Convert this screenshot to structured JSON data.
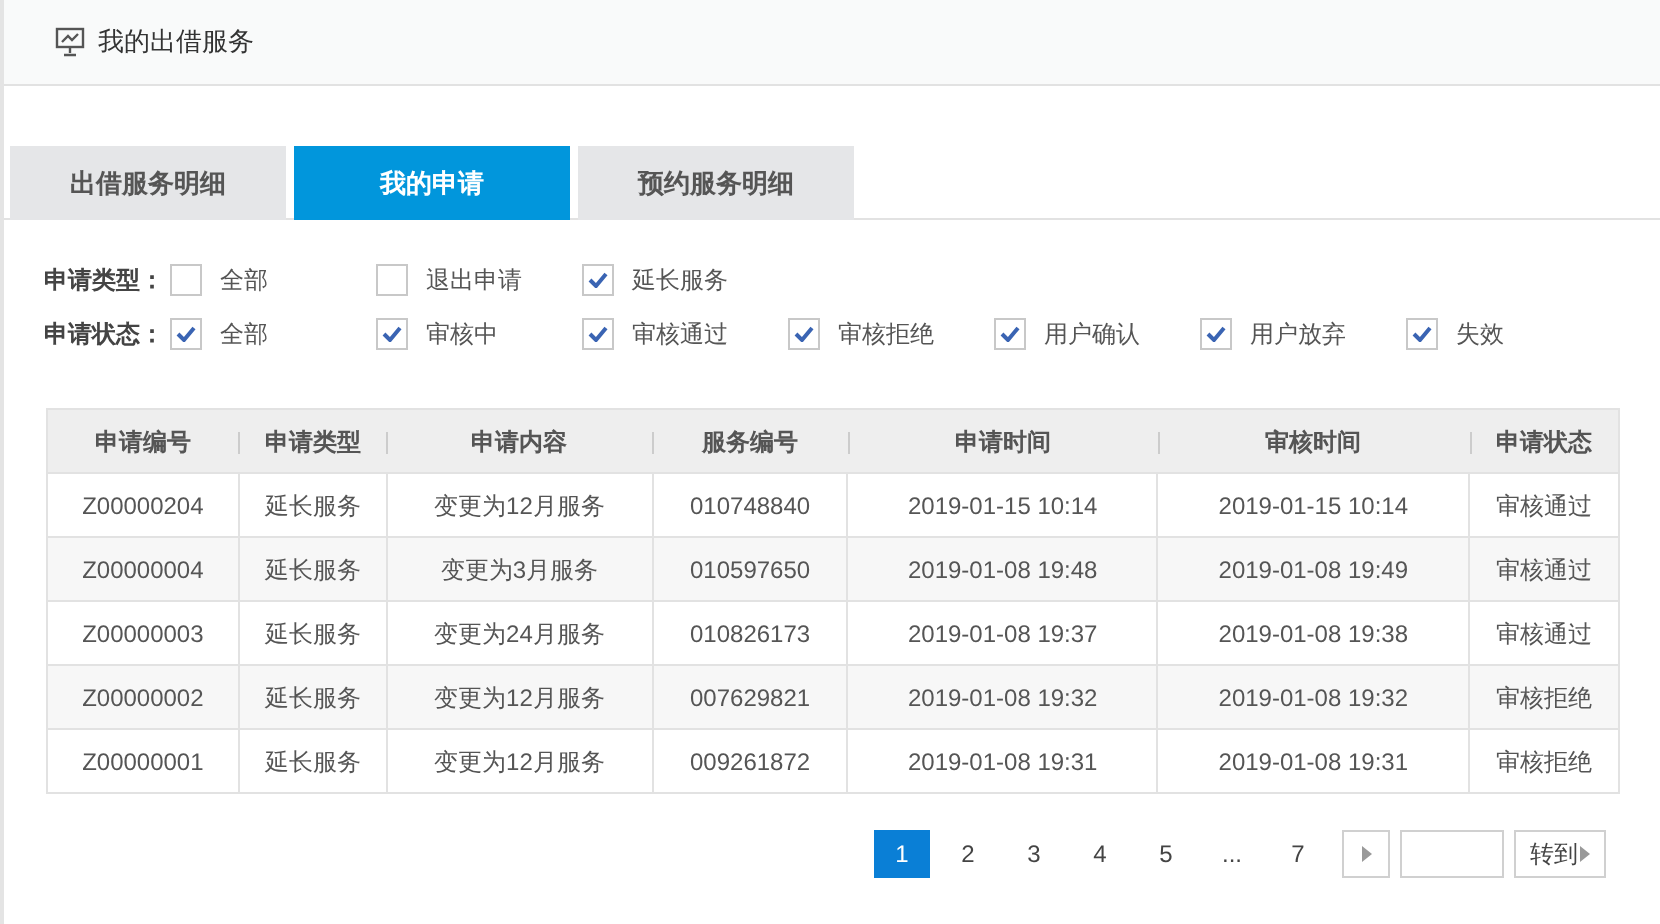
{
  "header": {
    "title": "我的出借服务"
  },
  "tabs": [
    {
      "label": "出借服务明细",
      "selected": false
    },
    {
      "label": "我的申请",
      "selected": true
    },
    {
      "label": "预约服务明细",
      "selected": false
    }
  ],
  "filters": [
    {
      "label": "申请类型：",
      "options": [
        {
          "label": "全部",
          "checked": false
        },
        {
          "label": "退出申请",
          "checked": false
        },
        {
          "label": "延长服务",
          "checked": true
        }
      ]
    },
    {
      "label": "申请状态：",
      "options": [
        {
          "label": "全部",
          "checked": true
        },
        {
          "label": "审核中",
          "checked": true
        },
        {
          "label": "审核通过",
          "checked": true
        },
        {
          "label": "审核拒绝",
          "checked": true
        },
        {
          "label": "用户确认",
          "checked": true
        },
        {
          "label": "用户放弃",
          "checked": true
        },
        {
          "label": "失效",
          "checked": true
        }
      ]
    }
  ],
  "table": {
    "columns": [
      "申请编号",
      "申请类型",
      "申请内容",
      "服务编号",
      "申请时间",
      "审核时间",
      "申请状态"
    ],
    "rows": [
      [
        "Z00000204",
        "延长服务",
        "变更为12月服务",
        "010748840",
        "2019-01-15 10:14",
        "2019-01-15 10:14",
        "审核通过"
      ],
      [
        "Z00000004",
        "延长服务",
        "变更为3月服务",
        "010597650",
        "2019-01-08 19:48",
        "2019-01-08 19:49",
        "审核通过"
      ],
      [
        "Z00000003",
        "延长服务",
        "变更为24月服务",
        "010826173",
        "2019-01-08 19:37",
        "2019-01-08 19:38",
        "审核通过"
      ],
      [
        "Z00000002",
        "延长服务",
        "变更为12月服务",
        "007629821",
        "2019-01-08 19:32",
        "2019-01-08 19:32",
        "审核拒绝"
      ],
      [
        "Z00000001",
        "延长服务",
        "变更为12月服务",
        "009261872",
        "2019-01-08 19:31",
        "2019-01-08 19:31",
        "审核拒绝"
      ]
    ]
  },
  "pagination": {
    "pages": [
      {
        "label": "1",
        "selected": true
      },
      {
        "label": "2",
        "selected": false
      },
      {
        "label": "3",
        "selected": false
      },
      {
        "label": "4",
        "selected": false
      },
      {
        "label": "5",
        "selected": false
      },
      {
        "label": "...",
        "selected": false
      },
      {
        "label": "7",
        "selected": false
      }
    ],
    "goto_label": "转到"
  }
}
